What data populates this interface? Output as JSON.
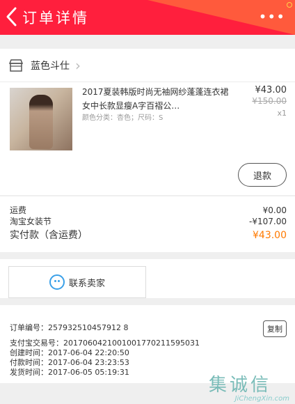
{
  "header": {
    "title": "订单详情",
    "more_label": "•••"
  },
  "shop": {
    "name": "蓝色斗仕",
    "chevron": "›"
  },
  "product": {
    "title": "2017夏装韩版时尚无袖网纱蓬蓬连衣裙女中长款显瘦A字百褶公…",
    "sku": "颜色分类：杏色；尺码：S",
    "price": "¥43.00",
    "original_price": "¥150.00",
    "quantity": "x1",
    "refund_label": "退款"
  },
  "costs": [
    {
      "label": "运费",
      "value": "¥0.00"
    },
    {
      "label": "淘宝女装节",
      "value": "-¥107.00"
    }
  ],
  "total": {
    "label": "实付款（含运费）",
    "value": "¥43.00"
  },
  "contact": {
    "label": "联系卖家"
  },
  "order_info": {
    "order_no": "订单编号：257932510457912 8",
    "copy_label": "复制",
    "alipay_no": "支付宝交易号：2017060421001001770211595031",
    "created": "创建时间：2017-06-04 22:20:50",
    "paid": "付款时间：2017-06-04 23:23:53",
    "shipped": "发货时间：2017-06-05 05:19:31"
  },
  "watermark": {
    "text": "集诚信",
    "url": "JiChengXin.com"
  },
  "colors": {
    "header_red": "#ff1f3d",
    "header_orange": "#ff5a3c",
    "total_orange": "#ff7a00",
    "wangwang_blue": "#3aa0e8"
  },
  "icons": {
    "back": "chevron-left-icon",
    "more": "more-dots-icon",
    "shop": "shop-icon",
    "contact": "wangwang-icon"
  }
}
